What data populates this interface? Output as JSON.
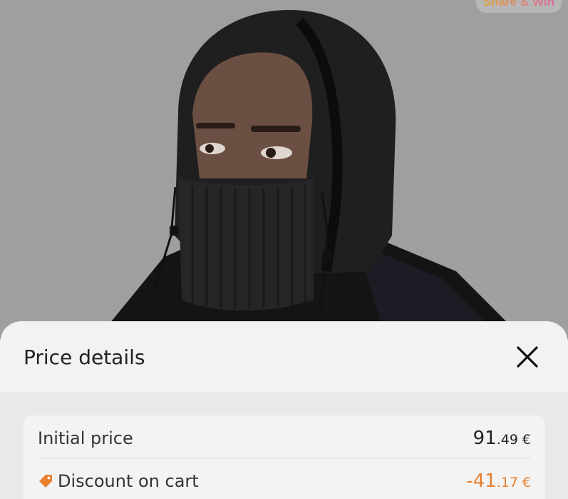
{
  "badge": {
    "label": "Share & Win"
  },
  "sheet": {
    "title": "Price details",
    "close_label": "close"
  },
  "rows": [
    {
      "label": "Initial price",
      "price_int": "91",
      "price_dec": ".49",
      "currency": "€"
    },
    {
      "label": "Discount on cart",
      "price_int": "-41",
      "price_dec": ".17",
      "currency": "€"
    }
  ],
  "colors": {
    "discount": "#e8802e",
    "sheet_bg": "#f2f2f2",
    "title_text": "#222222"
  },
  "icons": [
    "close-icon",
    "tag-icon"
  ]
}
